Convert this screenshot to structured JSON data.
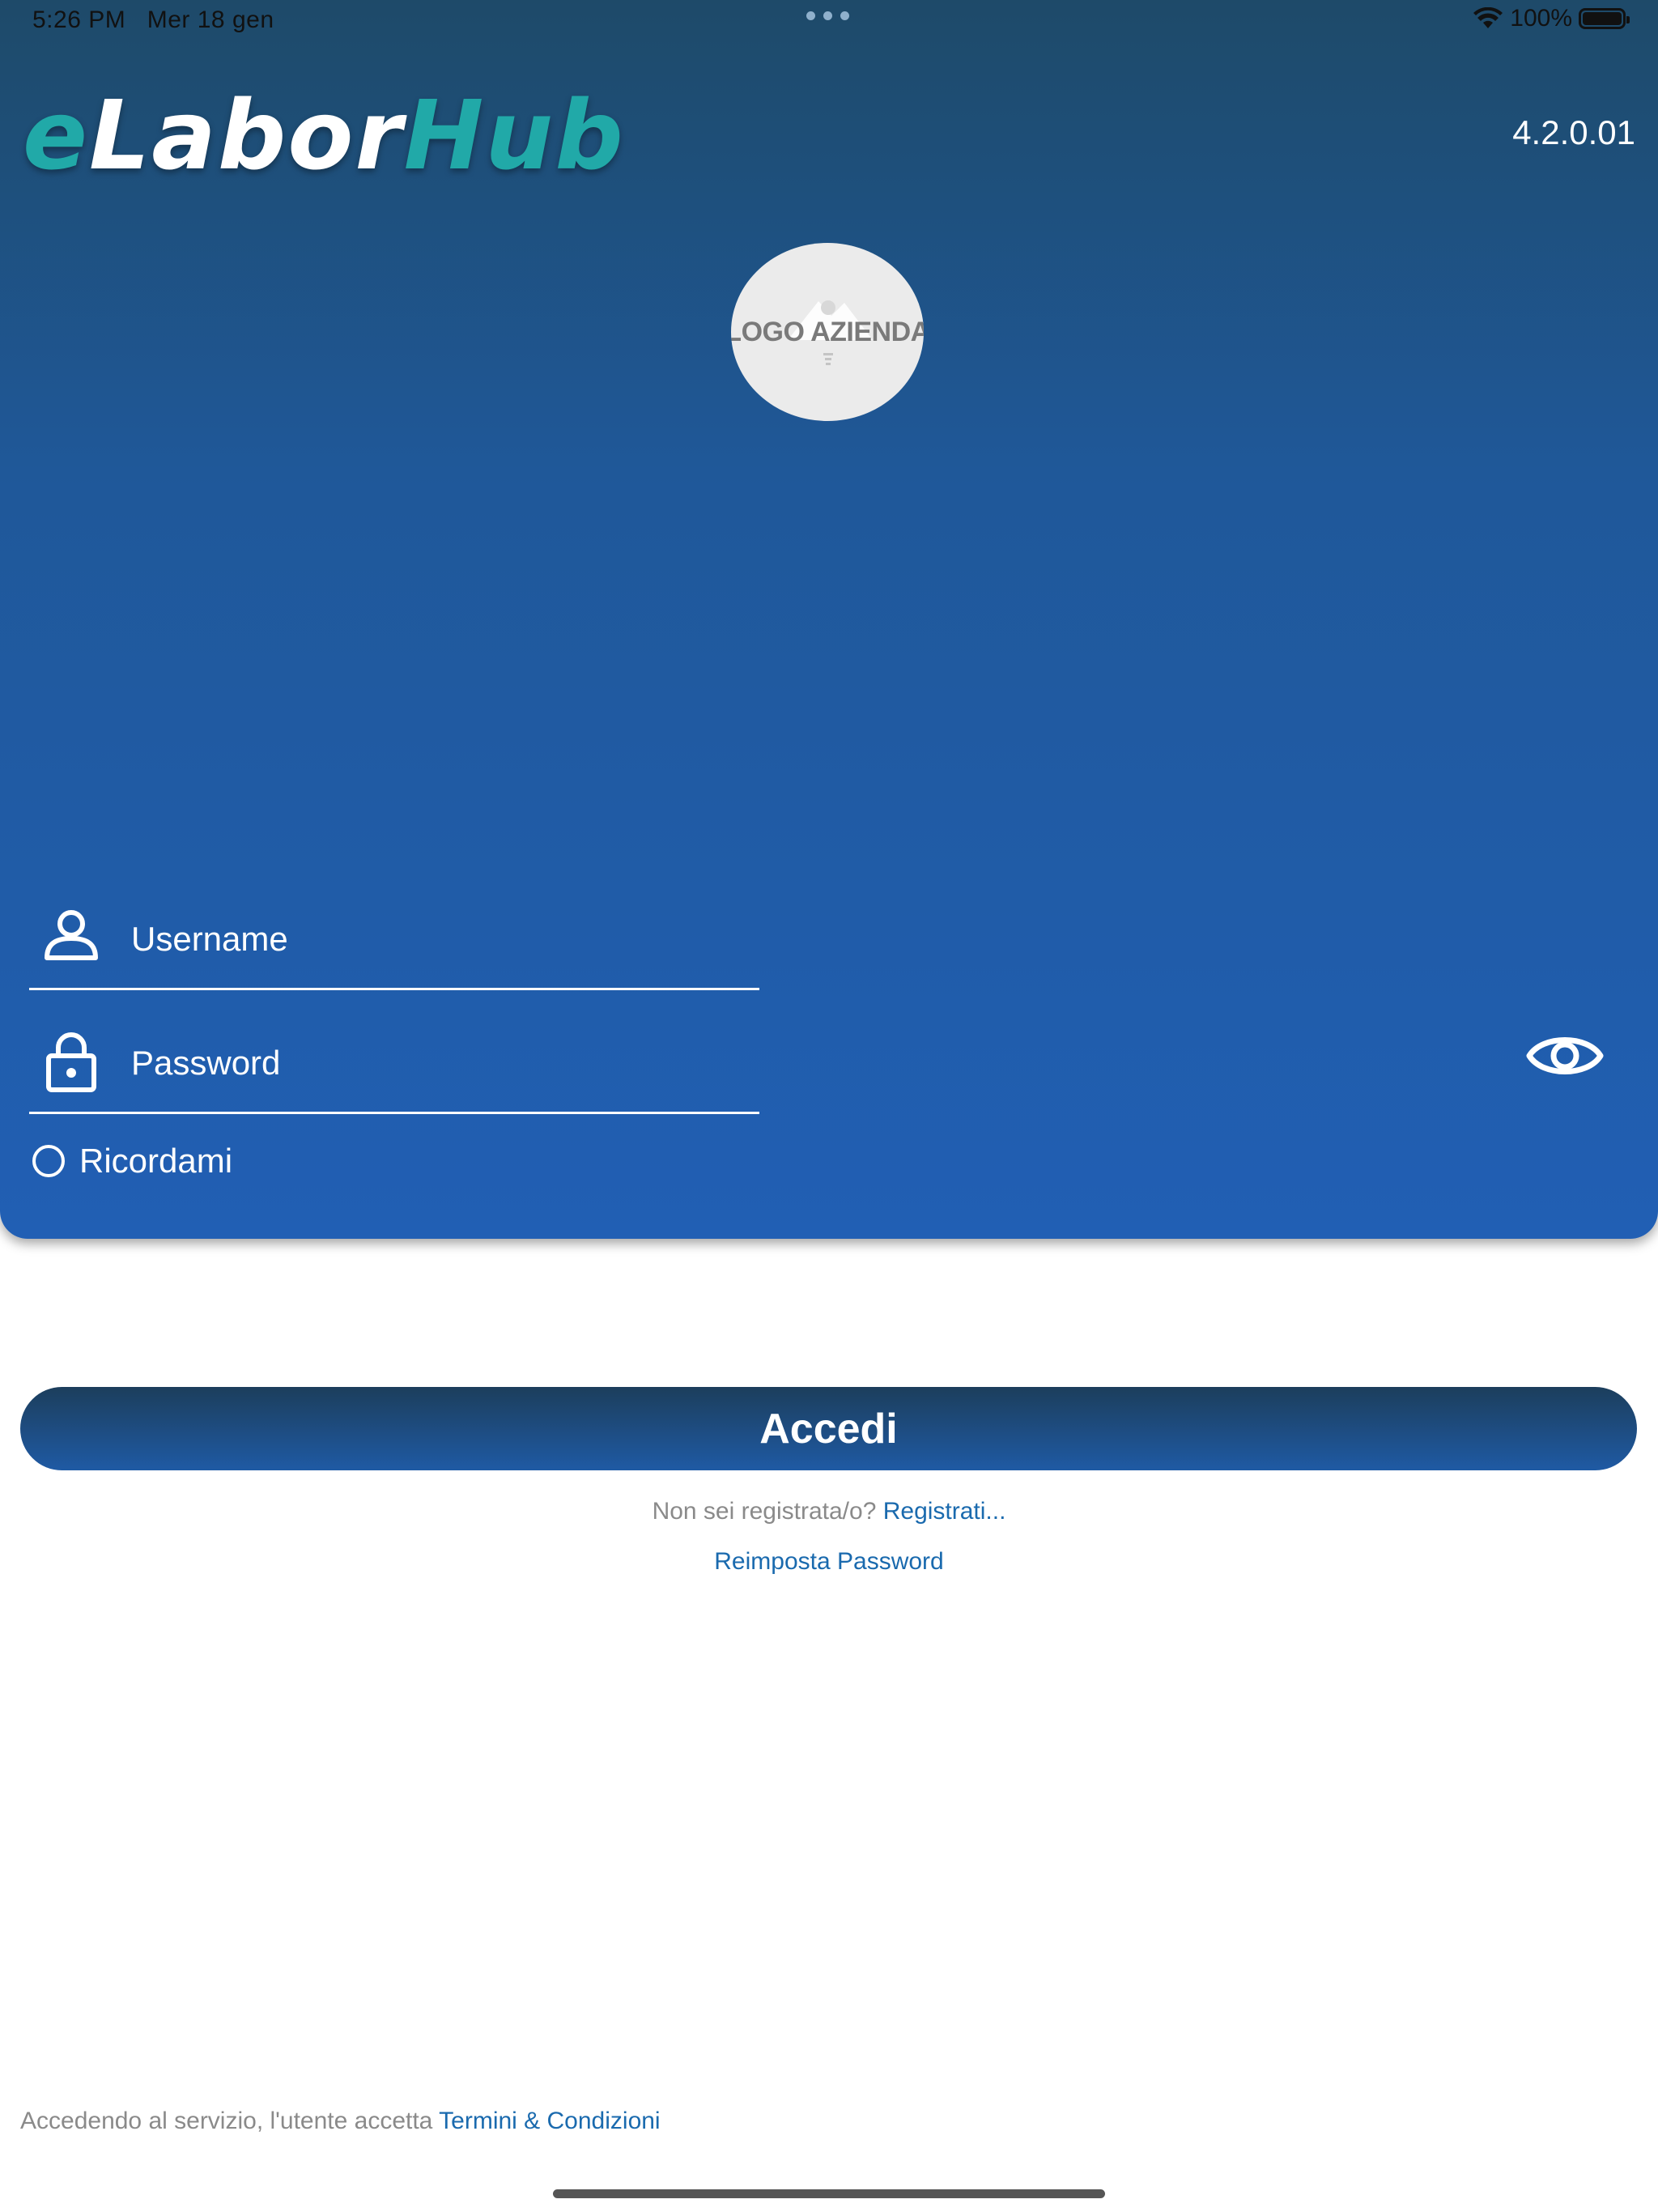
{
  "status_bar": {
    "time": "5:26 PM",
    "date": "Mer 18 gen",
    "battery": "100%",
    "battery_level": 1.0,
    "wifi_icon": "wifi-icon"
  },
  "header": {
    "brand": {
      "e": "e",
      "labor": "Labor",
      "hub": "Hub"
    },
    "version": "4.2.0.01",
    "company_logo_text": "LOGO AZIENDA"
  },
  "form": {
    "username_placeholder": "Username",
    "password_placeholder": "Password",
    "remember_label": "Ricordami",
    "icons": {
      "username": "user-icon",
      "password": "lock-icon",
      "toggle": "eye-icon"
    }
  },
  "actions": {
    "login_label": "Accedi",
    "register_prompt": "Non sei registrata/o?",
    "register_link": "Registrati...",
    "reset_link": "Reimposta Password"
  },
  "footer": {
    "terms_prompt": "Accedendo al servizio, l'utente accetta",
    "terms_link": "Termini & Condizioni"
  },
  "colors": {
    "accent_teal": "#21a9a8",
    "hero_top": "#1e4a69",
    "hero_bottom": "#215fb4",
    "link": "#1a6aae"
  }
}
